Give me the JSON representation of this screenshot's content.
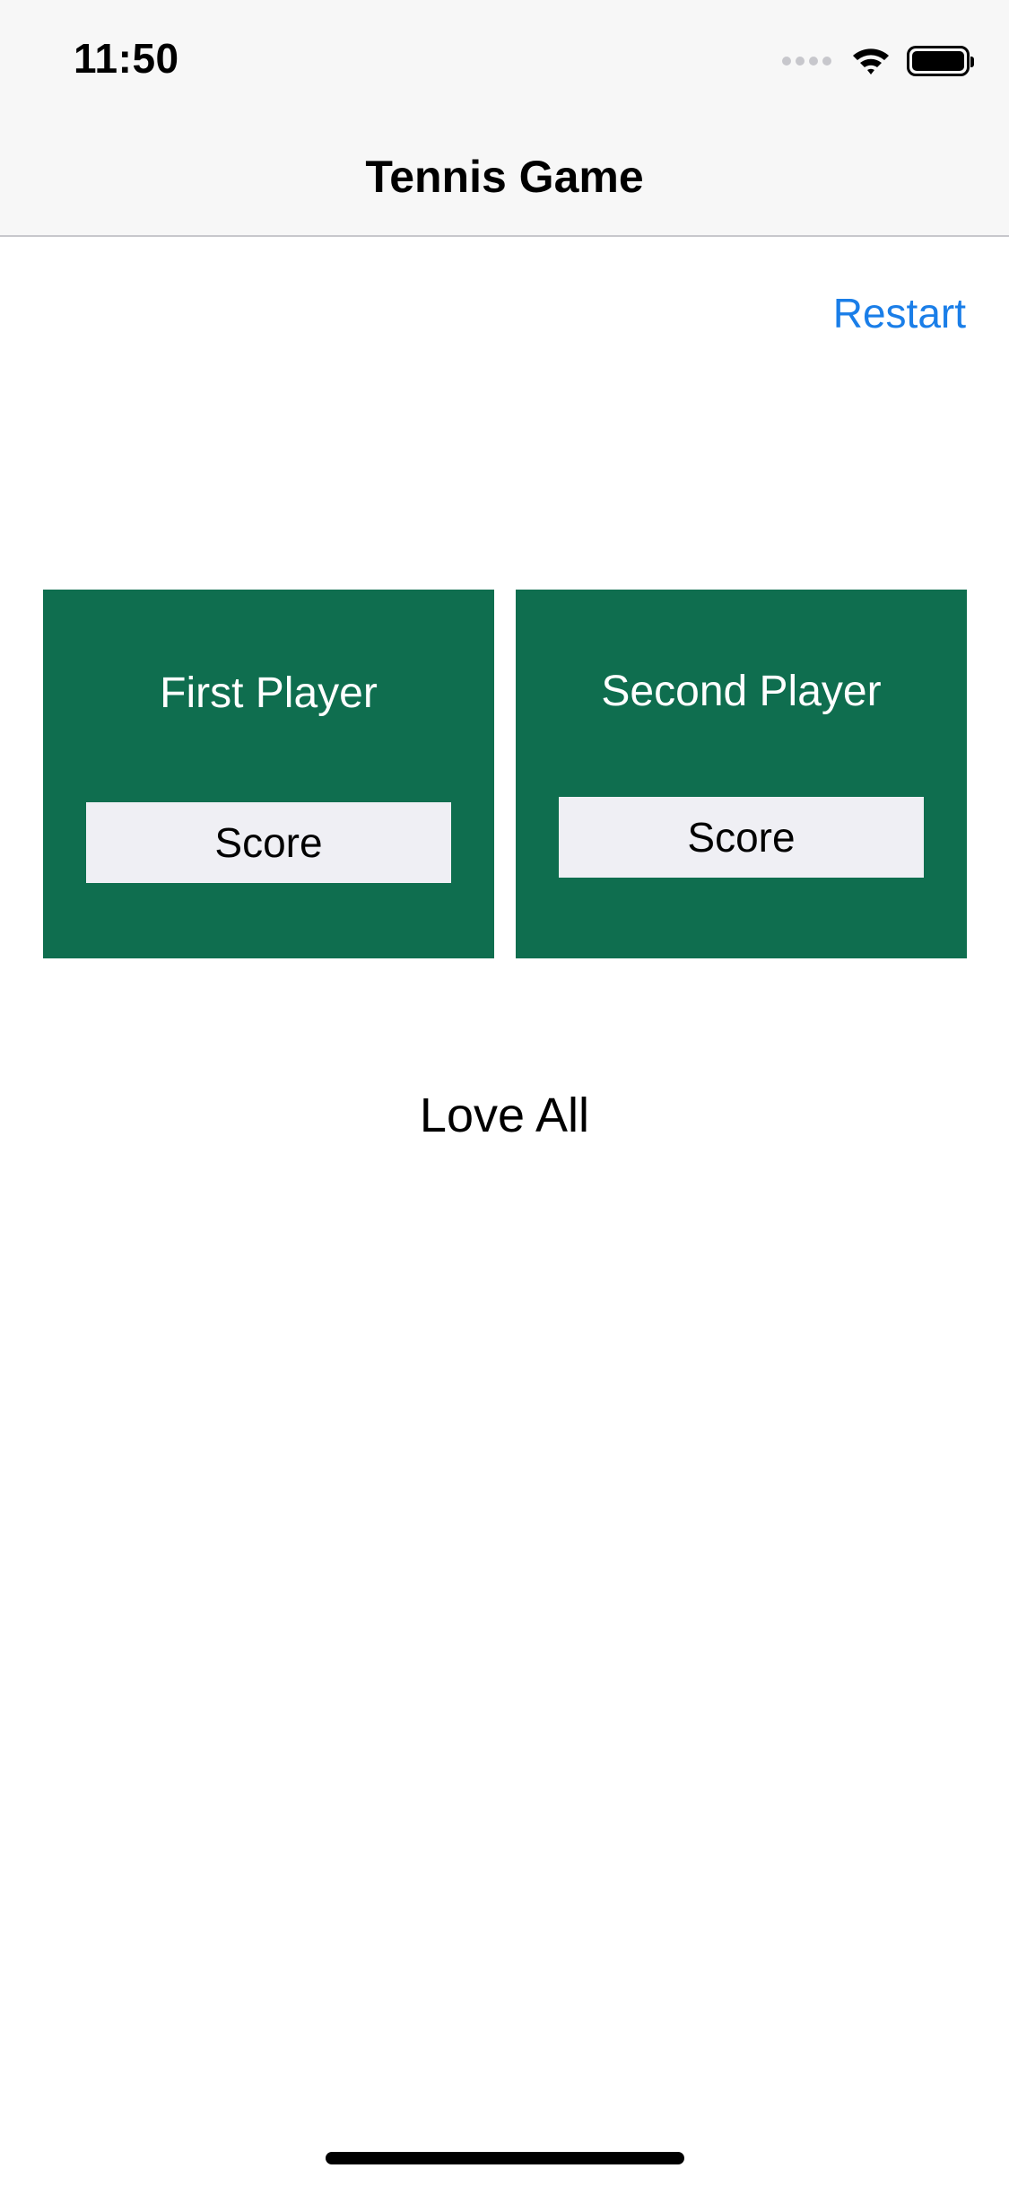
{
  "status_bar": {
    "time": "11:50",
    "icons": [
      "cellular-signal-icon",
      "wifi-icon",
      "battery-icon"
    ]
  },
  "nav": {
    "title": "Tennis Game"
  },
  "toolbar": {
    "restart_label": "Restart"
  },
  "players": [
    {
      "name": "First Player",
      "score_label": "Score"
    },
    {
      "name": "Second Player",
      "score_label": "Score"
    }
  ],
  "game": {
    "status": "Love All"
  },
  "colors": {
    "card_background": "#0f6e4f",
    "accent": "#1a7ee8",
    "button_background": "#efeff4"
  }
}
